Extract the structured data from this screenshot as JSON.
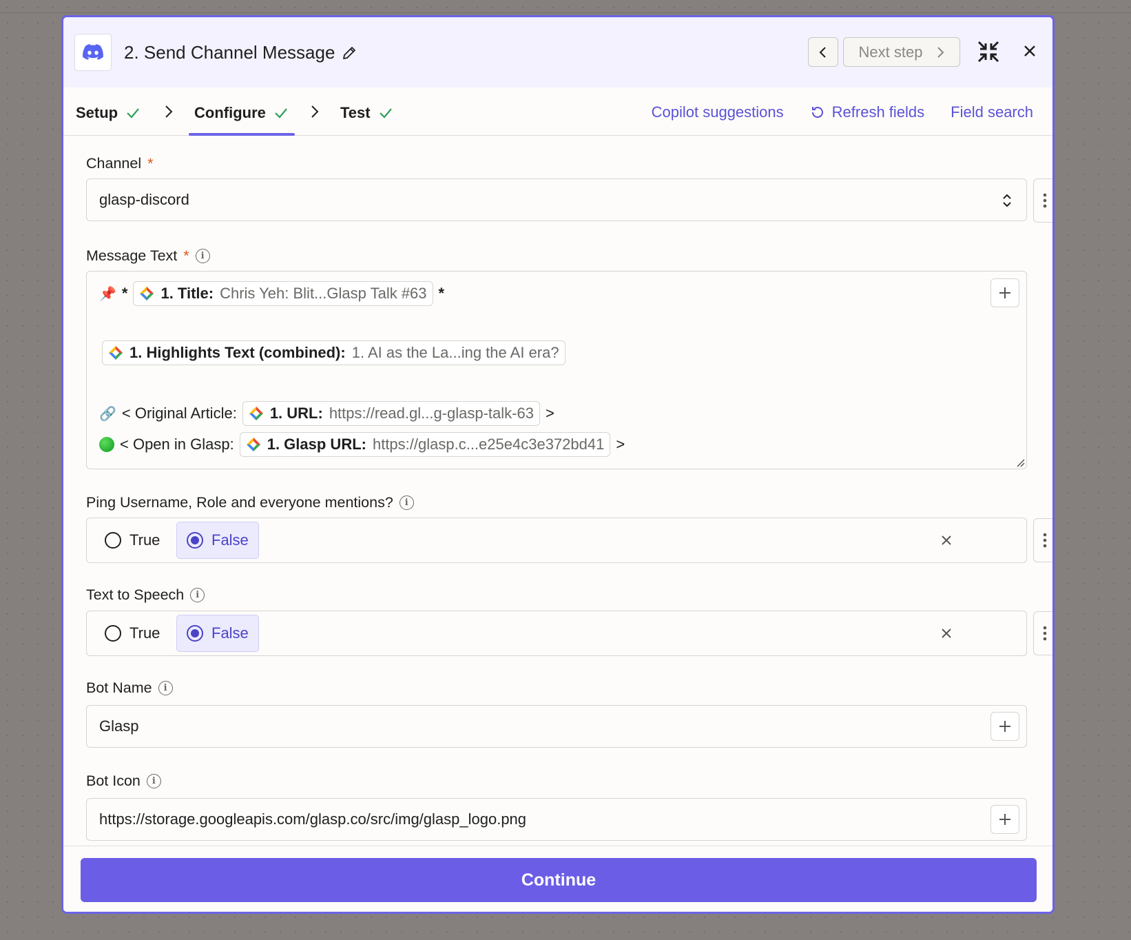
{
  "header": {
    "title": "2. Send Channel Message",
    "next_step_label": "Next step"
  },
  "tabs": [
    {
      "label": "Setup"
    },
    {
      "label": "Configure"
    },
    {
      "label": "Test"
    }
  ],
  "actions": {
    "copilot": "Copilot suggestions",
    "refresh": "Refresh fields",
    "search": "Field search"
  },
  "fields": {
    "channel": {
      "label": "Channel",
      "required": "*",
      "value": "glasp-discord"
    },
    "message": {
      "label": "Message Text",
      "required": "*",
      "line1_prefix": "*",
      "line1_suffix": "*",
      "title_pill": {
        "key": "1. Title:",
        "value": "Chris Yeh: Blit...Glasp Talk #63"
      },
      "highlights_pill": {
        "key": "1. Highlights Text (combined):",
        "value": "1. AI as the La...ing the AI era?"
      },
      "article_prefix": "< Original Article:",
      "url_pill": {
        "key": "1. URL:",
        "value": "https://read.gl...g-glasp-talk-63"
      },
      "article_suffix": ">",
      "glasp_prefix": "< Open in Glasp:",
      "glasp_pill": {
        "key": "1. Glasp URL:",
        "value": "https://glasp.c...e25e4c3e372bd41"
      },
      "glasp_suffix": ">"
    },
    "ping": {
      "label": "Ping Username, Role and everyone mentions?",
      "true_label": "True",
      "false_label": "False"
    },
    "tts": {
      "label": "Text to Speech",
      "true_label": "True",
      "false_label": "False"
    },
    "bot_name": {
      "label": "Bot Name",
      "value": "Glasp"
    },
    "bot_icon": {
      "label": "Bot Icon",
      "value": "https://storage.googleapis.com/glasp.co/src/img/glasp_logo.png"
    }
  },
  "footer": {
    "continue_label": "Continue"
  },
  "colors": {
    "accent": "#6b5de6",
    "required": "#e0531b",
    "success": "#2e9e5b"
  }
}
